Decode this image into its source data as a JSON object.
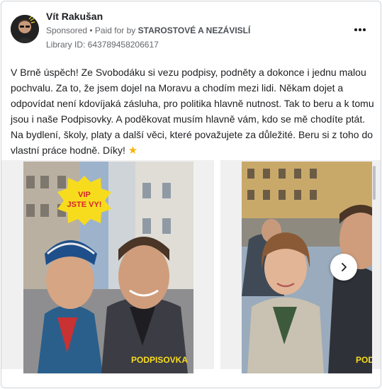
{
  "post": {
    "author": "Vít Rakušan",
    "sponsored": "Sponsored",
    "paid_for_prefix": "• Paid for by",
    "paid_for_by": "STAROSTOVÉ A NEZÁVISLÍ",
    "library_id": "Library ID: 643789458206617",
    "body": "V Brně úspěch! Ze Svobodáku si vezu podpisy, podněty a dokonce i jednu malou pochvalu. Za to, že jsem dojel na Moravu a chodím mezi lidi. Někam dojet a odpovídat není kdovíjaká zásluha, pro politika hlavně nutnost. Tak to beru a k tomu jsou i naše Podpisovky. A poděkovat musím hlavně vám, kdo se mě chodíte ptát. Na bydlení, školy, platy a další věci, které považujete za důležité. Beru si z toho do vlastní práce hodně. Díky!",
    "emoji": "★"
  },
  "carousel": {
    "slide1": {
      "sticker_line1": "VIP",
      "sticker_line2": "JSTE VY!",
      "caption": "PODPISOVKA"
    },
    "slide2": {
      "caption": "POD"
    }
  },
  "colors": {
    "accent_yellow": "#f7dc1e",
    "text": "#1c1e21",
    "muted": "#65676b"
  },
  "icons": [
    "more-options-icon",
    "chevron-right-icon",
    "star-emoji-icon"
  ]
}
